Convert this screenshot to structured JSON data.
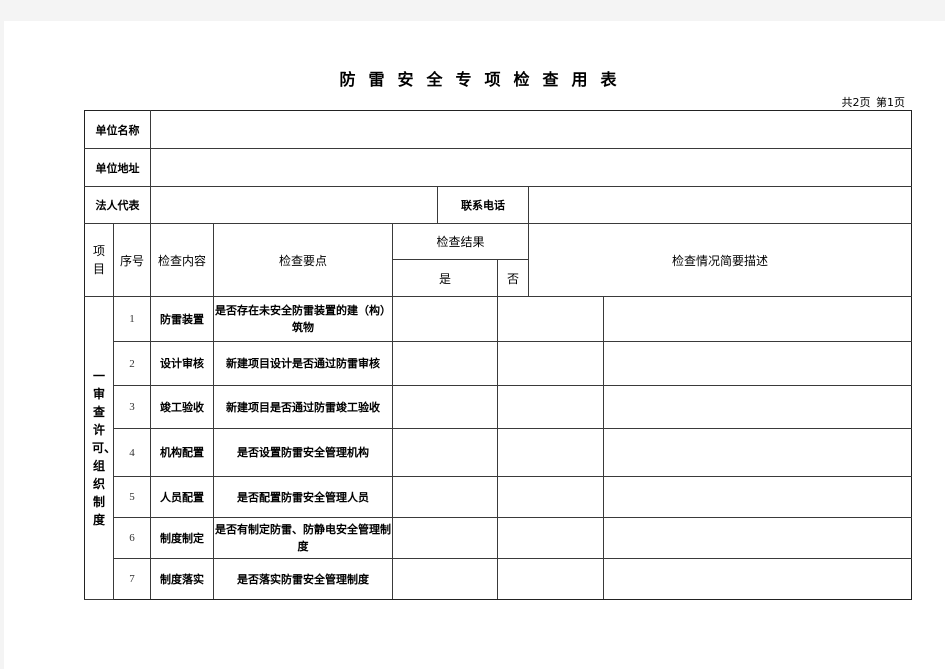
{
  "document": {
    "title": "防雷安全专项检查用表",
    "page_counter": {
      "total": "共2页",
      "current": "第1页"
    }
  },
  "info_fields": {
    "unit_name_label": "单位名称",
    "unit_name_value": "",
    "unit_address_label": "单位地址",
    "unit_address_value": "",
    "legal_rep_label": "法人代表",
    "legal_rep_value": "",
    "phone_label": "联系电话",
    "phone_value": ""
  },
  "table_header": {
    "category": "项目",
    "seq": "序号",
    "content": "检查内容",
    "key_points": "检查要点",
    "result": "检查结果",
    "result_yes": "是",
    "result_no": "否",
    "description": "检查情况简要描述"
  },
  "category_group": {
    "label": "一审查许可、组织制度",
    "rows": [
      {
        "seq": "1",
        "content": "防雷装置",
        "key_point": "是否存在未安全防雷装置的建（构）筑物",
        "yes": "",
        "no": "",
        "description": ""
      },
      {
        "seq": "2",
        "content": "设计审核",
        "key_point": "新建项目设计是否通过防雷审核",
        "yes": "",
        "no": "",
        "description": ""
      },
      {
        "seq": "3",
        "content": "竣工验收",
        "key_point": "新建项目是否通过防雷竣工验收",
        "yes": "",
        "no": "",
        "description": ""
      },
      {
        "seq": "4",
        "content": "机构配置",
        "key_point": "是否设置防雷安全管理机构",
        "yes": "",
        "no": "",
        "description": ""
      },
      {
        "seq": "5",
        "content": "人员配置",
        "key_point": "是否配置防雷安全管理人员",
        "yes": "",
        "no": "",
        "description": ""
      },
      {
        "seq": "6",
        "content": "制度制定",
        "key_point": "是否有制定防雷、防静电安全管理制度",
        "yes": "",
        "no": "",
        "description": ""
      },
      {
        "seq": "7",
        "content": "制度落实",
        "key_point": "是否落实防雷安全管理制度",
        "yes": "",
        "no": "",
        "description": ""
      }
    ]
  }
}
